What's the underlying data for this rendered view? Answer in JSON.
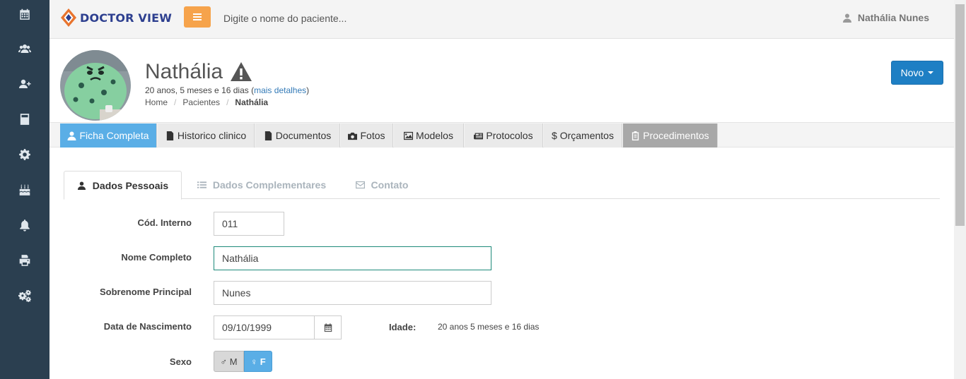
{
  "app": {
    "logo_text": "DOCTOR VIEW"
  },
  "search": {
    "placeholder": "Digite o nome do paciente..."
  },
  "user": {
    "name": "Nathália Nunes"
  },
  "patient": {
    "name": "Nathália",
    "age_text": "20 anos, 5 meses e 16 dias (",
    "details_link": "mais detalhes",
    "age_close": ")"
  },
  "breadcrumb": {
    "home": "Home",
    "patients": "Pacientes",
    "current": "Nathália",
    "sep": "/"
  },
  "novo_button": {
    "label": "Novo"
  },
  "main_tabs": [
    {
      "label": "Ficha Completa",
      "icon": "user-icon"
    },
    {
      "label": "Historico clinico",
      "icon": "file-icon"
    },
    {
      "label": "Documentos",
      "icon": "file-icon"
    },
    {
      "label": "Fotos",
      "icon": "camera-icon"
    },
    {
      "label": "Modelos",
      "icon": "image-icon"
    },
    {
      "label": "Protocolos",
      "icon": "newspaper-icon"
    },
    {
      "label": "$ Orçamentos",
      "icon": ""
    },
    {
      "label": "Procedimentos",
      "icon": "clipboard-icon"
    }
  ],
  "sub_tabs": [
    {
      "label": "Dados Pessoais",
      "icon": "user-icon"
    },
    {
      "label": "Dados Complementares",
      "icon": "list-icon"
    },
    {
      "label": "Contato",
      "icon": "envelope-icon"
    }
  ],
  "form": {
    "cod_interno": {
      "label": "Cód. Interno",
      "value": "011"
    },
    "nome_completo": {
      "label": "Nome Completo",
      "value": "Nathália"
    },
    "sobrenome": {
      "label": "Sobrenome Principal",
      "value": "Nunes"
    },
    "nascimento": {
      "label": "Data de Nascimento",
      "value": "09/10/1999"
    },
    "idade": {
      "label": "Idade:",
      "value": "20 anos 5 meses e 16 dias"
    },
    "sexo": {
      "label": "Sexo",
      "male": "♂ M",
      "female": "♀ F",
      "selected": "F"
    }
  },
  "colors": {
    "sidebar": "#2b3f50",
    "accent_orange": "#f6a34b",
    "primary_blue": "#1e7fc4",
    "active_tab": "#5aaee6"
  },
  "sidebar_icons": [
    "calendar-icon",
    "users-icon",
    "user-plus-icon",
    "calculator-icon",
    "gear-icon",
    "birthday-cake-icon",
    "bell-icon",
    "print-icon",
    "gears-icon"
  ]
}
